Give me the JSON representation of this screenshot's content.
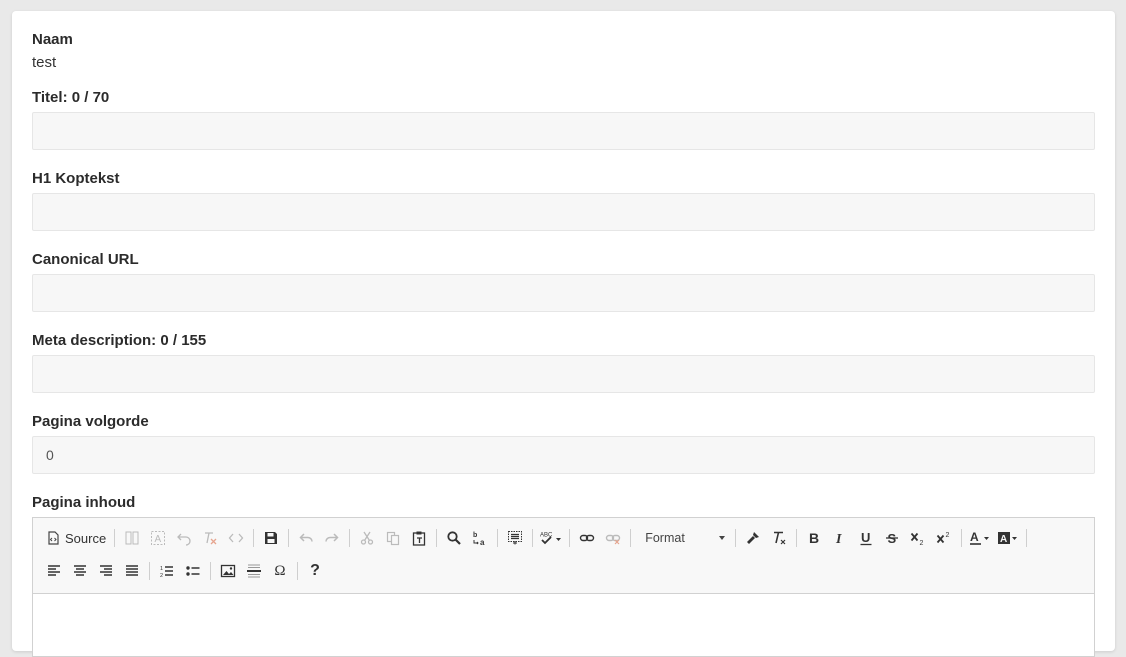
{
  "fields": {
    "naam": {
      "label": "Naam",
      "value": "test"
    },
    "titel": {
      "label": "Titel: 0 / 70",
      "value": ""
    },
    "h1": {
      "label": "H1 Koptekst",
      "value": ""
    },
    "canonical": {
      "label": "Canonical URL",
      "value": ""
    },
    "meta": {
      "label": "Meta description: 0 / 155",
      "value": ""
    },
    "volgorde": {
      "label": "Pagina volgorde",
      "value": "0"
    },
    "inhoud": {
      "label": "Pagina inhoud"
    }
  },
  "editor": {
    "source_label": "Source",
    "format_label": "Format",
    "special_char": "Ω",
    "help": "?",
    "toolbar_icons": [
      "source-icon",
      "template-icon",
      "select-all-icon",
      "undo-hint-icon",
      "remove-format-alt-icon",
      "code-icon",
      "save-icon",
      "undo-icon",
      "redo-icon",
      "cut-icon",
      "copy-icon",
      "paste-text-icon",
      "find-icon",
      "replace-icon",
      "show-blocks-icon",
      "spellcheck-icon",
      "link-icon",
      "unlink-icon",
      "copy-format-icon",
      "remove-format-icon",
      "bold-icon",
      "italic-icon",
      "underline-icon",
      "strikethrough-icon",
      "subscript-icon",
      "superscript-icon",
      "text-color-icon",
      "background-color-icon",
      "align-left-icon",
      "align-center-icon",
      "align-right-icon",
      "justify-icon",
      "numbered-list-icon",
      "bulleted-list-icon",
      "image-icon",
      "horizontal-rule-icon",
      "special-char-icon",
      "help-icon"
    ]
  }
}
